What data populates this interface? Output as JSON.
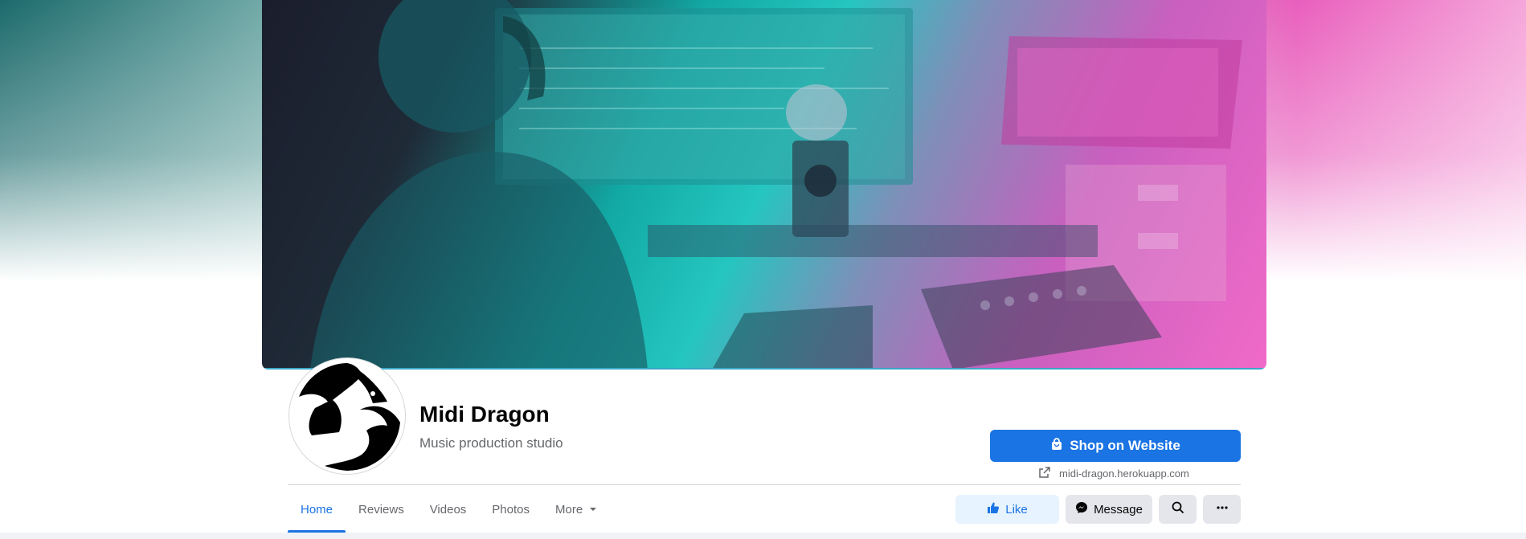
{
  "page": {
    "name": "Midi Dragon",
    "category": "Music production studio"
  },
  "cta": {
    "shop_label": "Shop on Website",
    "website": "midi-dragon.herokuapp.com"
  },
  "tabs": [
    {
      "label": "Home",
      "active": true
    },
    {
      "label": "Reviews",
      "active": false
    },
    {
      "label": "Videos",
      "active": false
    },
    {
      "label": "Photos",
      "active": false
    },
    {
      "label": "More",
      "active": false
    }
  ],
  "actions": {
    "like_label": "Like",
    "message_label": "Message"
  },
  "colors": {
    "accent": "#1b74e4",
    "like_bg": "#e7f3ff",
    "button_bg": "#e4e6eb",
    "secondary_text": "#65676b"
  },
  "icons": {
    "shop": "shopping-bag-icon",
    "link": "external-link-icon",
    "more": "caret-down-icon",
    "like": "thumbs-up-icon",
    "message": "messenger-icon",
    "search": "search-icon",
    "overflow": "ellipsis-icon"
  }
}
